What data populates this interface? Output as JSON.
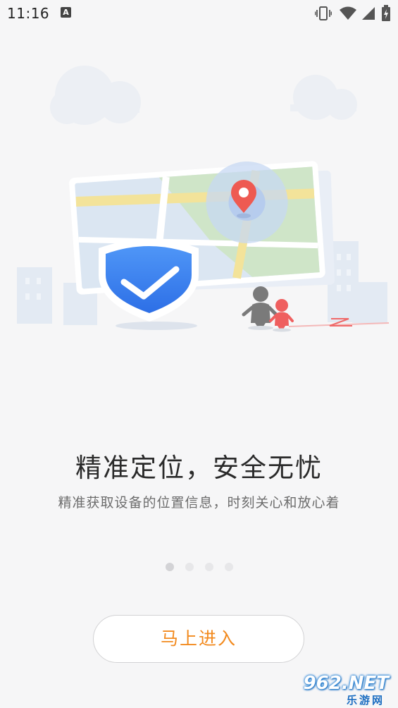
{
  "status_bar": {
    "time": "11:16",
    "notification_icon": "A",
    "icons": [
      "vibrate-icon",
      "wifi-icon",
      "signal-icon",
      "battery-icon"
    ]
  },
  "illustration": {
    "name": "map-location-shield-illustration",
    "colors": {
      "map_land": "#dbe6f2",
      "map_park": "#cfe5c8",
      "map_road": "#f3e39a",
      "pin": "#ee5a52",
      "shield": "#2f7cf0",
      "adult_figure": "#7a7a7a",
      "child_figure": "#ef5f5f"
    }
  },
  "onboarding": {
    "title": "精准定位，安全无忧",
    "subtitle": "精准获取设备的位置信息，时刻关心和放心着"
  },
  "pager": {
    "count": 4,
    "active_index": 0
  },
  "enter_button": {
    "label": "马上进入",
    "color": "#f28a1e"
  },
  "watermark": {
    "main": "962.NET",
    "sub": "乐游网"
  }
}
